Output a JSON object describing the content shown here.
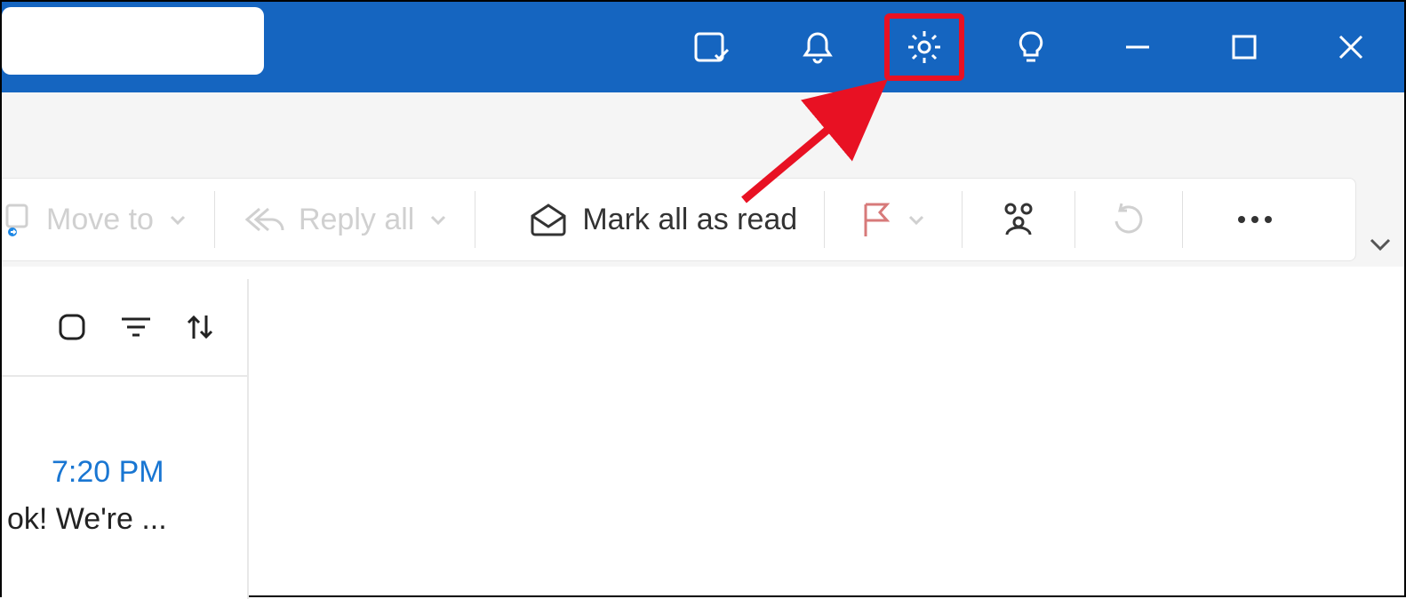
{
  "toolbar": {
    "move_to": "Move to",
    "reply_all": "Reply all",
    "mark_all_read": "Mark all as read"
  },
  "message": {
    "time": "7:20 PM",
    "preview": "ok! We're ..."
  },
  "annotation": {
    "target": "settings-button"
  }
}
